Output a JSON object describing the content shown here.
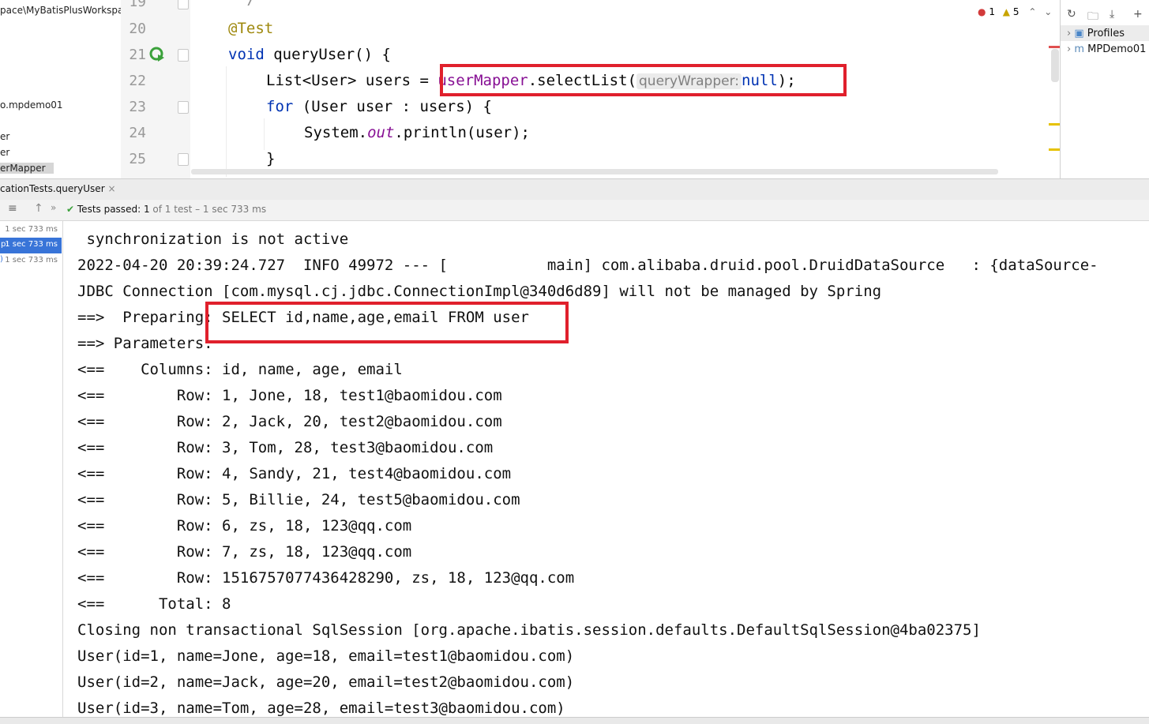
{
  "tree": {
    "items": [
      {
        "label": "pace\\MyBatisPlusWorkspa",
        "selected": false
      },
      {
        "label": "o.mpdemo01",
        "selected": false
      },
      {
        "label": "er",
        "selected": false
      },
      {
        "label": "er",
        "selected": false
      },
      {
        "label": "erMapper",
        "selected": true
      }
    ]
  },
  "editor": {
    "line_numbers": [
      "19",
      "20",
      "21",
      "22",
      "23",
      "24",
      "25"
    ],
    "lines": {
      "l19": "*/",
      "l20": "@Test",
      "l21_kw": "void",
      "l21_rest": " queryUser() {",
      "l22_a": "List<User> users = ",
      "l22_field": "userMapper",
      "l22_b": ".selectList(",
      "l22_hint": "queryWrapper:",
      "l22_null": "null",
      "l22_c": ");",
      "l23_kw": "for",
      "l23_rest": " (User user : users) {",
      "l24_a": "System.",
      "l24_out": "out",
      "l24_b": ".println(user);",
      "l25": "}"
    },
    "inspection": {
      "errors": "1",
      "warnings": "5"
    }
  },
  "maven": {
    "items": [
      "Profiles",
      "MPDemo01"
    ]
  },
  "run": {
    "tab_label": "cationTests.queryUser",
    "status_label": "Tests passed:",
    "status_count": "1",
    "status_rest": "of 1 test – 1 sec 733 ms",
    "times": [
      "1 sec 733 ms",
      "1 sec 733 ms",
      "1 sec 733 ms"
    ],
    "selected_prefix": "p:"
  },
  "console": {
    "lines": [
      " synchronization is not active",
      "2022-04-20 20:39:24.727  INFO 49972 --- [           main] com.alibaba.druid.pool.DruidDataSource   : {dataSource-",
      "JDBC Connection [com.mysql.cj.jdbc.ConnectionImpl@340d6d89] will not be managed by Spring",
      "==>  Preparing: SELECT id,name,age,email FROM user",
      "==> Parameters: ",
      "<==    Columns: id, name, age, email",
      "<==        Row: 1, Jone, 18, test1@baomidou.com",
      "<==        Row: 2, Jack, 20, test2@baomidou.com",
      "<==        Row: 3, Tom, 28, test3@baomidou.com",
      "<==        Row: 4, Sandy, 21, test4@baomidou.com",
      "<==        Row: 5, Billie, 24, test5@baomidou.com",
      "<==        Row: 6, zs, 18, 123@qq.com",
      "<==        Row: 7, zs, 18, 123@qq.com",
      "<==        Row: 1516757077436428290, zs, 18, 123@qq.com",
      "<==      Total: 8",
      "Closing non transactional SqlSession [org.apache.ibatis.session.defaults.DefaultSqlSession@4ba02375]",
      "User(id=1, name=Jone, age=18, email=test1@baomidou.com)",
      "User(id=2, name=Jack, age=20, email=test2@baomidou.com)",
      "User(id=3, name=Tom, age=28, email=test3@baomidou.com)"
    ]
  },
  "colors": {
    "highlight_box": "#e0202c",
    "pass_green": "#3ba13b",
    "selection": "#3874d8"
  }
}
